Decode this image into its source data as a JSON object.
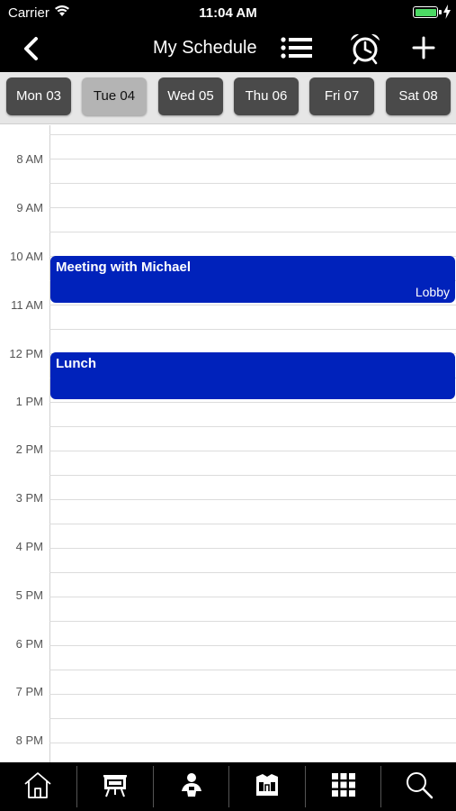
{
  "status_bar": {
    "carrier": "Carrier",
    "time": "11:04 AM",
    "battery_level": 1.0
  },
  "nav": {
    "title": "My Schedule",
    "back_icon": "chevron-left-icon",
    "list_icon": "list-icon",
    "alarm_icon": "alarm-clock-icon",
    "add_icon": "plus-icon"
  },
  "days": [
    {
      "label": "Mon 03",
      "selected": false
    },
    {
      "label": "Tue 04",
      "selected": true
    },
    {
      "label": "Wed 05",
      "selected": false
    },
    {
      "label": "Thu 06",
      "selected": false
    },
    {
      "label": "Fri 07",
      "selected": false
    },
    {
      "label": "Sat 08",
      "selected": false
    }
  ],
  "hours": [
    "8 AM",
    "9 AM",
    "10 AM",
    "11 AM",
    "12 PM",
    "1 PM",
    "2 PM",
    "3 PM",
    "4 PM",
    "5 PM",
    "6 PM",
    "7 PM",
    "8 PM"
  ],
  "events": [
    {
      "title": "Meeting with Michael",
      "location": "Lobby"
    },
    {
      "title": "Lunch",
      "location": ""
    }
  ],
  "tabs": [
    "home-icon",
    "presentation-icon",
    "speaker-icon",
    "map-icon",
    "grid-icon",
    "search-icon"
  ],
  "colors": {
    "event": "#0022bb",
    "bar": "#000000",
    "day_button": "#4a4a4a",
    "day_selected": "#b4b4b4"
  }
}
